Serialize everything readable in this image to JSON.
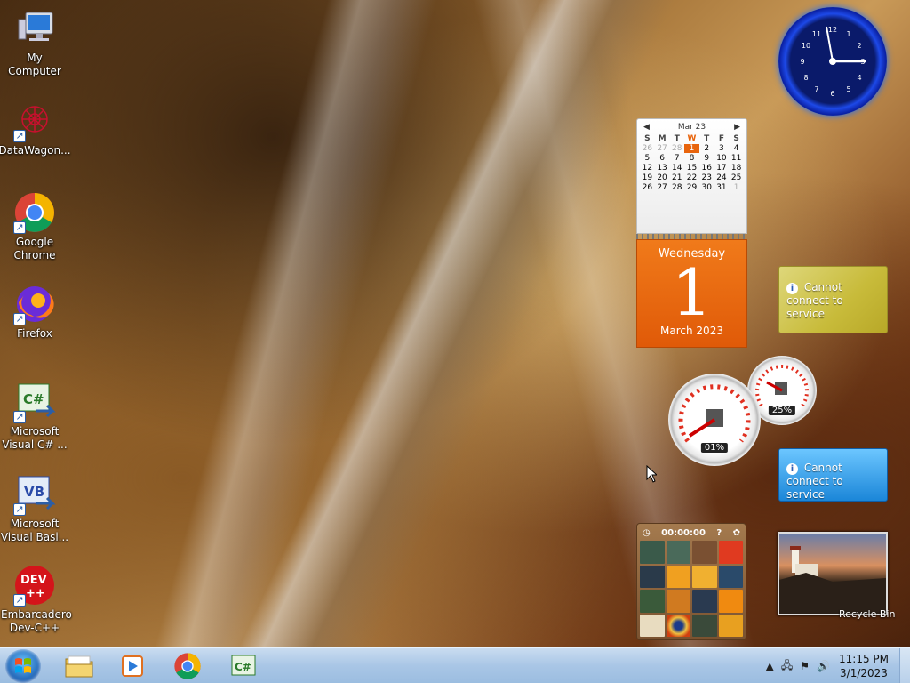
{
  "desktop_icons": [
    {
      "label": "My Computer",
      "icon": "computer-icon"
    },
    {
      "label": "DataWagon...",
      "icon": "datawagon-icon"
    },
    {
      "label": "Google Chrome",
      "icon": "chrome-icon"
    },
    {
      "label": "Firefox",
      "icon": "firefox-icon"
    },
    {
      "label": "Microsoft Visual C# ...",
      "icon": "visual-csharp-icon"
    },
    {
      "label": "Microsoft Visual Basi...",
      "icon": "visual-basic-icon"
    },
    {
      "label": "Embarcadero Dev-C++",
      "icon": "devcpp-icon"
    }
  ],
  "calendar": {
    "month_label": "Mar 23",
    "days_of_week": [
      "S",
      "M",
      "T",
      "W",
      "T",
      "F",
      "S"
    ],
    "weeks": [
      [
        "26",
        "27",
        "28",
        "1",
        "2",
        "3",
        "4"
      ],
      [
        "5",
        "6",
        "7",
        "8",
        "9",
        "10",
        "11"
      ],
      [
        "12",
        "13",
        "14",
        "15",
        "16",
        "17",
        "18"
      ],
      [
        "19",
        "20",
        "21",
        "22",
        "23",
        "24",
        "25"
      ],
      [
        "26",
        "27",
        "28",
        "29",
        "30",
        "31",
        "1"
      ]
    ],
    "weekday": "Wednesday",
    "day": "1",
    "month_year": "March 2023"
  },
  "feeds": {
    "yellow_message": "Cannot connect to service",
    "blue_message": "Cannot connect to service"
  },
  "cpu_meter": {
    "cpu_percent": "01%",
    "memory_percent": "25%"
  },
  "puzzle": {
    "timer": "00:00:00",
    "help_label": "?"
  },
  "recycle_bin_label": "Recycle Bin",
  "taskbar": {
    "apps": [
      "file-explorer-icon",
      "media-player-icon",
      "chrome-icon",
      "visual-csharp-icon"
    ],
    "time": "11:15 PM",
    "date": "3/1/2023"
  },
  "colors": {
    "calendar_accent": "#e8640c",
    "clock_blue": "#1d49e8",
    "taskbar": "#b3cde8"
  }
}
